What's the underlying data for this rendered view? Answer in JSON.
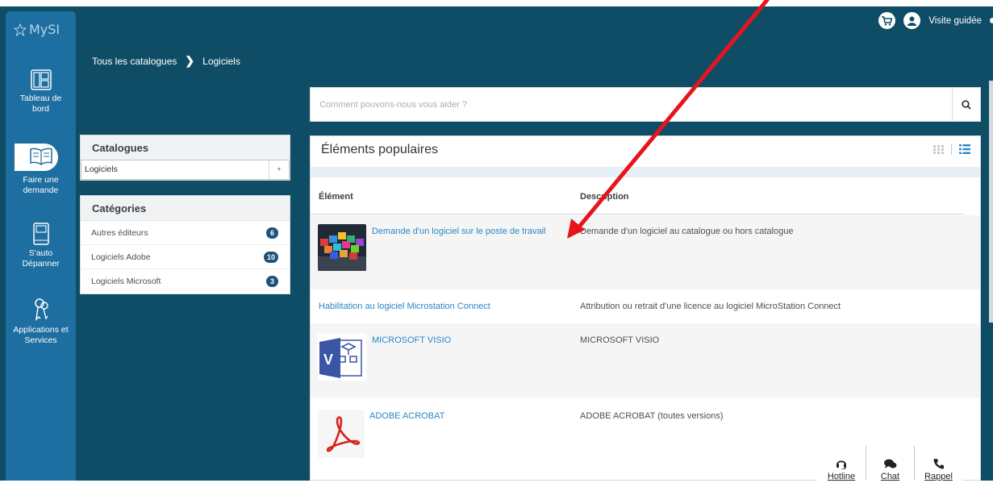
{
  "app": {
    "logo": "MySI"
  },
  "header": {
    "breadcrumb": [
      "Tous les catalogues",
      "Logiciels"
    ],
    "guided_tour": "Visite guidée"
  },
  "sidebar": {
    "items": [
      {
        "label": "Tableau de bord",
        "icon": "dashboard-icon"
      },
      {
        "label": "Faire une demande",
        "icon": "book-icon"
      },
      {
        "label": "S'auto Dépanner",
        "icon": "manual-icon"
      },
      {
        "label": "Applications et Services",
        "icon": "keys-icon"
      }
    ]
  },
  "search": {
    "placeholder": "Comment pouvons-nous vous aider ?"
  },
  "catalogues": {
    "title": "Catalogues",
    "selected": "Logiciels"
  },
  "categories": {
    "title": "Catégories",
    "items": [
      {
        "label": "Autres éditeurs",
        "count": "6"
      },
      {
        "label": "Logiciels Adobe",
        "count": "10"
      },
      {
        "label": "Logiciels Microsoft",
        "count": "3"
      }
    ]
  },
  "popular": {
    "title": "Éléments populaires",
    "col_element": "Élément",
    "col_description": "Description",
    "rows": [
      {
        "name": "Demande d'un logiciel sur le poste de travail",
        "description": "Demande d'un logiciel au catalogue ou hors catalogue"
      },
      {
        "name": "Habilitation au logiciel Microstation Connect",
        "description": "Attribution ou retrait d'une licence au logiciel MicroStation Connect"
      },
      {
        "name": "MICROSOFT VISIO",
        "description": "MICROSOFT VISIO"
      },
      {
        "name": "ADOBE ACROBAT",
        "description": "ADOBE ACROBAT (toutes versions)"
      }
    ]
  },
  "contact": {
    "hotline": "Hotline",
    "chat": "Chat",
    "rappel": "Rappel"
  },
  "colors": {
    "header_bg": "#0f4d66",
    "sidebar_bg": "#1d6ea1",
    "link": "#2a86c6",
    "badge": "#1e5278",
    "arrow": "#e8141b"
  }
}
